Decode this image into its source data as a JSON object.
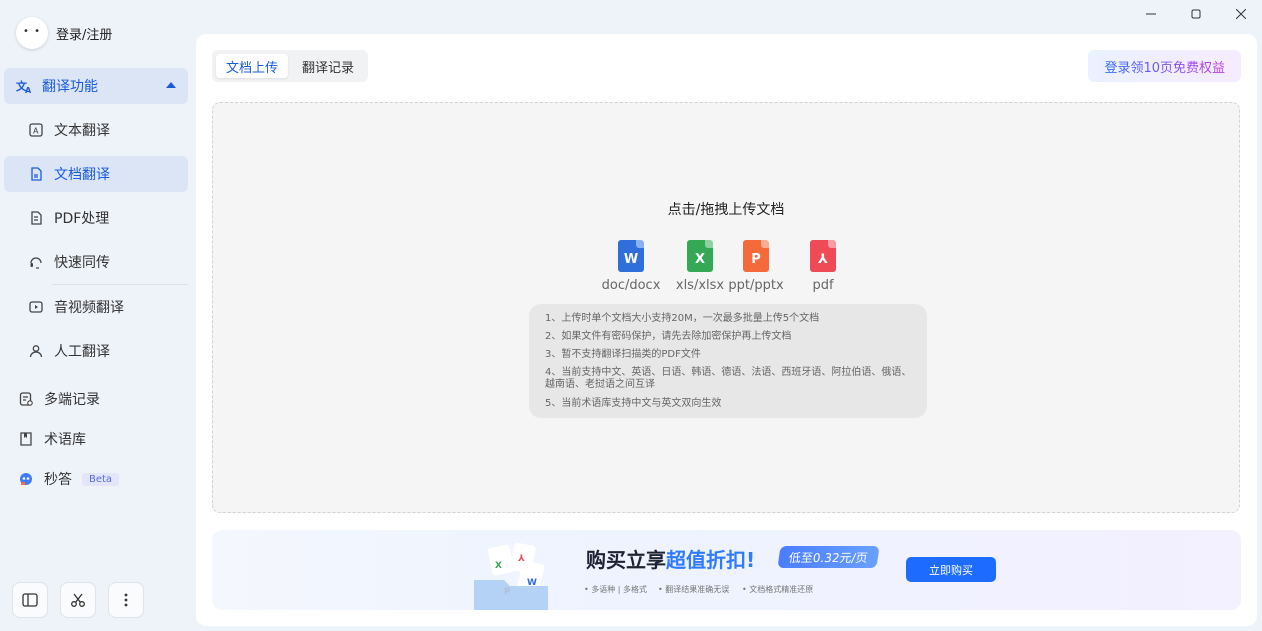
{
  "user": {
    "login_label": "登录/注册"
  },
  "nav": {
    "group_label": "翻译功能",
    "sub_items": [
      {
        "label": "文本翻译"
      },
      {
        "label": "文档翻译"
      },
      {
        "label": "PDF处理"
      },
      {
        "label": "快速同传"
      },
      {
        "label": "音视频翻译"
      },
      {
        "label": "人工翻译"
      }
    ],
    "top_items": [
      {
        "label": "多端记录"
      },
      {
        "label": "术语库"
      },
      {
        "label": "秒答",
        "badge": "Beta"
      }
    ]
  },
  "tabs": [
    {
      "label": "文档上传"
    },
    {
      "label": "翻译记录"
    }
  ],
  "promo_pill": "登录领10页免费权益",
  "upload": {
    "title": "点击/拖拽上传文档",
    "file_types": [
      {
        "glyph": "W",
        "label": "doc/docx",
        "color": "#2f6fdc"
      },
      {
        "glyph": "X",
        "label": "xls/xlsx",
        "color": "#35a855"
      },
      {
        "glyph": "P",
        "label": "ppt/pptx",
        "color": "#f46a3a"
      },
      {
        "glyph": "⅄",
        "label": "pdf",
        "color": "#ef4b56"
      }
    ],
    "tips": [
      "1、上传时单个文档大小支持20M，一次最多批量上传5个文档",
      "2、如果文件有密码保护，请先去除加密保护再上传文档",
      "3、暂不支持翻译扫描类的PDF文件",
      "4、当前支持中文、英语、日语、韩语、德语、法语、西班牙语、阿拉伯语、俄语、越南语、老挝语之间互译",
      "5、当前术语库支持中文与英文双向生效"
    ]
  },
  "banner": {
    "title_prefix": "购买立享",
    "title_highlight": "超值折扣",
    "title_suffix": "!",
    "badge": "低至0.32元/页",
    "features": [
      "多语种 | 多格式",
      "翻译结果准确无误",
      "文档格式精准还原"
    ],
    "button": "立即购买"
  },
  "colors": {
    "accent": "#1a5bdc",
    "button": "#1e6cff"
  }
}
